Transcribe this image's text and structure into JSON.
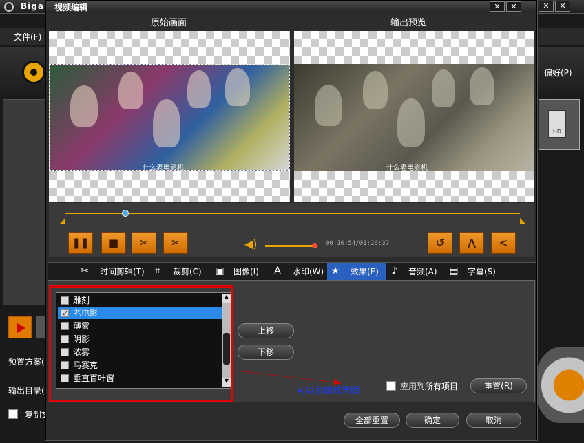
{
  "background_app": {
    "title": "Biga",
    "menu_file": "文件(F)",
    "menu_pref": "偏好(P)",
    "preset_label": "预置方案(",
    "output_dir_label": "输出目录(",
    "copy_label": "复制文",
    "hd_label": "HD"
  },
  "dialog": {
    "title": "视频编辑",
    "original_label": "原始画面",
    "output_label": "输出预览",
    "subtitle_orig": "什么老电影机",
    "subtitle_out": "什么老电影机",
    "timecode": "00:10:54/01:26:37",
    "timeline_position": 0.13,
    "volume": 1.0,
    "tabs": [
      {
        "label": "时间剪辑(T)",
        "icon": "scissors-icon"
      },
      {
        "label": "裁剪(C)",
        "icon": "crop-icon"
      },
      {
        "label": "图像(I)",
        "icon": "image-icon"
      },
      {
        "label": "水印(W)",
        "icon": "watermark-icon"
      },
      {
        "label": "效果(E)",
        "icon": "star-icon"
      },
      {
        "label": "音频(A)",
        "icon": "music-icon"
      },
      {
        "label": "字幕(S)",
        "icon": "subtitle-icon"
      }
    ],
    "active_tab": "效果(E)",
    "effects": [
      {
        "label": "雕刻",
        "checked": false,
        "selected": false
      },
      {
        "label": "老电影",
        "checked": true,
        "selected": true
      },
      {
        "label": "薄雾",
        "checked": false,
        "selected": false
      },
      {
        "label": "阴影",
        "checked": false,
        "selected": false
      },
      {
        "label": "浓雾",
        "checked": false,
        "selected": false
      },
      {
        "label": "马赛克",
        "checked": false,
        "selected": false
      },
      {
        "label": "垂直百叶窗",
        "checked": false,
        "selected": false
      }
    ],
    "move_up": "上移",
    "move_down": "下移",
    "hint": "可以添加效果图",
    "apply_all": "应用到所有项目",
    "reset": "重置(R)",
    "reset_all": "全部重置",
    "ok": "确定",
    "cancel": "取消"
  },
  "colors": {
    "accent": "#e8a400",
    "selection": "#2a8ae8",
    "highlight_box": "#e00000",
    "hint_text": "#1a3cff"
  }
}
